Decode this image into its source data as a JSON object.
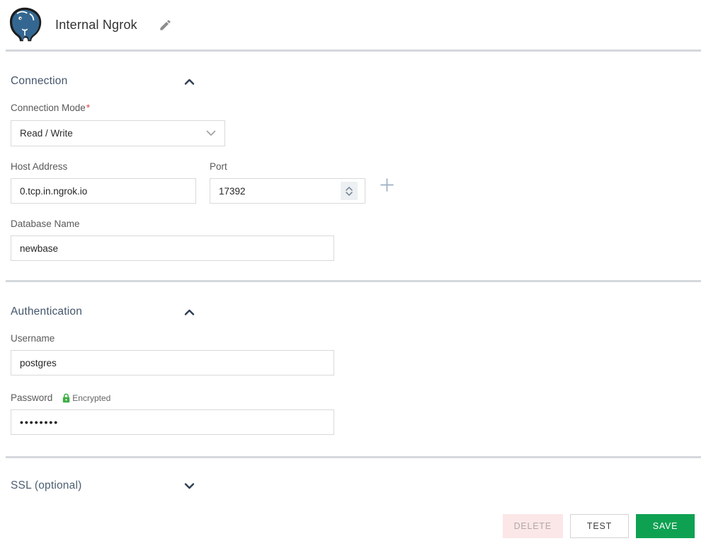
{
  "header": {
    "title": "Internal Ngrok",
    "logo_icon": "postgresql-elephant-logo",
    "edit_icon": "pencil-icon"
  },
  "sections": {
    "connection": {
      "title": "Connection",
      "state": "expanded",
      "fields": {
        "connection_mode": {
          "label": "Connection Mode",
          "required_mark": "*",
          "value": "Read / Write"
        },
        "host": {
          "label": "Host Address",
          "value": "0.tcp.in.ngrok.io"
        },
        "port": {
          "label": "Port",
          "value": "17392"
        },
        "database": {
          "label": "Database Name",
          "value": "newbase"
        }
      }
    },
    "authentication": {
      "title": "Authentication",
      "state": "expanded",
      "fields": {
        "username": {
          "label": "Username",
          "value": "postgres"
        },
        "password": {
          "label": "Password",
          "badge": "Encrypted",
          "value": "••••••••"
        }
      }
    },
    "ssl": {
      "title": "SSL (optional)",
      "state": "collapsed"
    }
  },
  "footer": {
    "delete_label": "DELETE",
    "test_label": "TEST",
    "save_label": "SAVE"
  },
  "colors": {
    "postgres_blue": "#336791",
    "section_title": "#44556b",
    "divider": "#d4d8dc",
    "required_red": "#e0494c",
    "encrypted_green": "#3ead44",
    "save_green": "#0fa152",
    "delete_bg": "#fbe7e7",
    "delete_text": "#b3a7a7",
    "input_border": "#d9d9d9"
  }
}
